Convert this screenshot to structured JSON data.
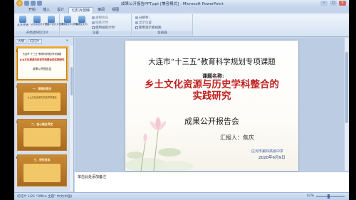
{
  "window": {
    "title": "成果公开报告PPT.ppt [兼容模式] - Microsoft PowerPoint",
    "minimize": "–",
    "maximize": "□",
    "close": "×"
  },
  "tabs": [
    "开始",
    "插入",
    "设计",
    "幻灯片放映",
    "审阅",
    "视图"
  ],
  "active_tab": 3,
  "ribbon": {
    "groups": [
      {
        "label": "开始放映幻灯片",
        "buttons": [
          "从头开始",
          "从当前幻灯片开始",
          "自定义幻灯片放映"
        ]
      },
      {
        "label": "设置",
        "buttons": [
          "设置幻灯片放映",
          "隐藏幻灯片"
        ],
        "small": [
          "录制旁白",
          "排练计时",
          "使用排练计时"
        ]
      },
      {
        "label": "监视器",
        "small": [
          "分辨率:",
          "显示位置:",
          "使用演示者视图"
        ]
      }
    ]
  },
  "left_pane": {
    "tab_outline": "大纲",
    "tab_slides": "幻灯片",
    "close": "×",
    "thumbs": [
      {
        "num": "1",
        "line1": "大连市“十三五”教育科学规划专项课题",
        "line2": "乡土文化资源与历史学科整合的实践研究",
        "line3": "成果公开报告会"
      },
      {
        "num": "2",
        "line1": "一、课题的提出",
        "line2": "乡土文化资源与历史学科整合",
        "line3": ""
      },
      {
        "num": "3",
        "line1": "二、核心概念界定",
        "line2": "",
        "line3": ""
      },
      {
        "num": "4",
        "line1": "三、研究目标",
        "line2": "",
        "line3": ""
      }
    ]
  },
  "slide": {
    "title": "大连市“十三五”教育科学规划专项课题",
    "topic_label": "课题名称:",
    "topic_line1": "乡土文化资源与历史学科整合的",
    "topic_line2": "实践研究",
    "subtitle": "成果公开报告会",
    "reporter": "汇报人：焦庆",
    "school": "庄河市第四高级中学",
    "date": "2020年6月9日"
  },
  "notes": {
    "placeholder": "单击此处添加备注"
  },
  "status": {
    "left": "幻灯片 1/25   \"Office 主题\"   中文(中国)",
    "zoom": "62%"
  }
}
